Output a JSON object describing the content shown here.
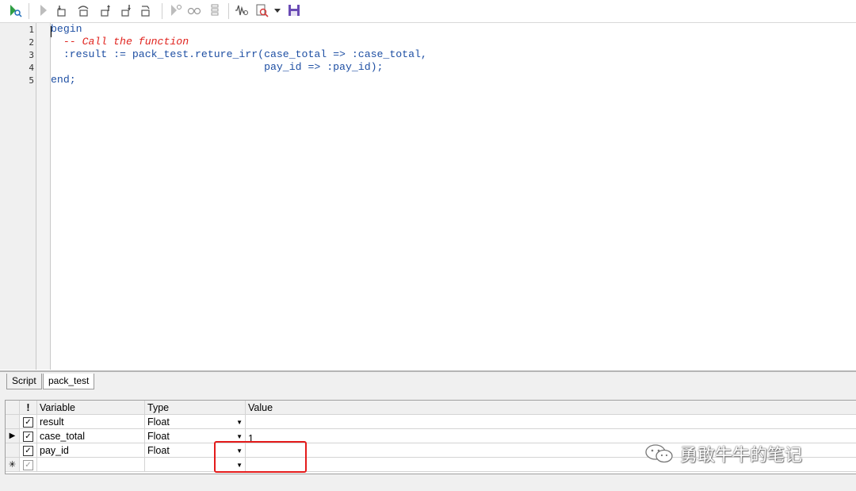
{
  "toolbar": {
    "icons": [
      "execute-icon",
      "run-icon",
      "step-into-icon",
      "step-over-icon",
      "step-out-icon",
      "run-to-exception-icon",
      "step-last-icon",
      "toggle-breakpoint-icon",
      "watch-icon",
      "call-stack-icon",
      "waveform-icon",
      "find-icon",
      "dropdown-arrow-icon",
      "save-icon"
    ]
  },
  "editor": {
    "line_numbers": [
      "1",
      "2",
      "3",
      "4",
      "5"
    ],
    "lines": [
      {
        "segments": [
          {
            "text": "begin",
            "style": "kw"
          }
        ]
      },
      {
        "segments": [
          {
            "text": "  -- Call the function",
            "style": "cm"
          }
        ]
      },
      {
        "segments": [
          {
            "text": "  :result := pack_test.reture_irr(case_total => :case_total,",
            "style": "tx"
          }
        ]
      },
      {
        "segments": [
          {
            "text": "                                  pay_id => :pay_id);",
            "style": "tx"
          }
        ]
      },
      {
        "segments": [
          {
            "text": "end;",
            "style": "kw"
          }
        ]
      }
    ]
  },
  "tabs": [
    {
      "label": "Script",
      "active": false
    },
    {
      "label": "pack_test",
      "active": true
    }
  ],
  "grid": {
    "headers": {
      "flag": "!",
      "variable": "Variable",
      "type": "Type",
      "value": "Value"
    },
    "rows": [
      {
        "checked": true,
        "variable": "result",
        "type": "Float",
        "value": "",
        "current": false
      },
      {
        "checked": true,
        "variable": "case_total",
        "type": "Float",
        "value": "1",
        "current": true
      },
      {
        "checked": true,
        "variable": "pay_id",
        "type": "Float",
        "value": "",
        "current": false
      },
      {
        "checked": true,
        "variable": "",
        "type": "",
        "value": "",
        "current": false,
        "new_row": true
      }
    ],
    "current_marker": "▶",
    "new_marker": "✳"
  },
  "watermark": {
    "text": "勇敢牛牛的笔记"
  },
  "colors": {
    "highlight_box": "#e41b1b",
    "keyword": "#1e4fa3",
    "comment": "#e0231e"
  }
}
